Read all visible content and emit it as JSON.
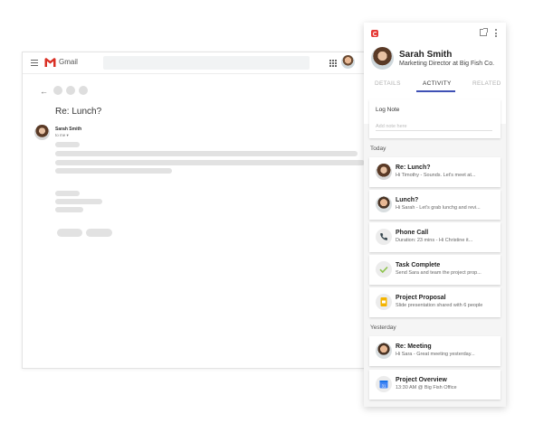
{
  "gmail": {
    "app_name": "Gmail",
    "subject": "Re: Lunch?",
    "sender_name": "Sarah Smith",
    "sender_to": "to me ▾"
  },
  "panel": {
    "contact_name": "Sarah Smith",
    "contact_title": "Marketing Director at Big Fish Co.",
    "tabs": [
      {
        "label": "DETAILS",
        "active": false
      },
      {
        "label": "ACTIVITY",
        "active": true
      },
      {
        "label": "RELATED",
        "active": false
      }
    ],
    "log_note": {
      "title": "Log Note",
      "placeholder": "Add note here"
    },
    "sections": {
      "today": "Today",
      "yesterday": "Yesterday"
    },
    "activities_today": [
      {
        "title": "Re: Lunch?",
        "subtitle": "Hi Timothy - Sounds. Let's meet at...",
        "icon": "avatar-sarah"
      },
      {
        "title": "Lunch?",
        "subtitle": "Hi Sarah - Let's grab lunchg and revi...",
        "icon": "avatar-timothy"
      },
      {
        "title": "Phone Call",
        "subtitle": "Duration: 23 mins - Hi Christine it...",
        "icon": "phone-icon"
      },
      {
        "title": "Task Complete",
        "subtitle": "Send Sara and team the project prop...",
        "icon": "checkmark-icon"
      },
      {
        "title": "Project Proposal",
        "subtitle": "Slide presentation shared with 6 people",
        "icon": "slides-icon"
      }
    ],
    "activities_yesterday": [
      {
        "title": "Re: Meeting",
        "subtitle": "Hi Sara - Great meeting yesterday...",
        "icon": "avatar-timothy"
      },
      {
        "title": "Project Overview",
        "subtitle": "13:30 AM @ Big Fish Office",
        "icon": "calendar-icon"
      }
    ]
  },
  "colors": {
    "accent": "#3f51b5",
    "brand": "#e53935",
    "check": "#8bc34a",
    "slides": "#f4b400",
    "calendar": "#4285f4"
  }
}
